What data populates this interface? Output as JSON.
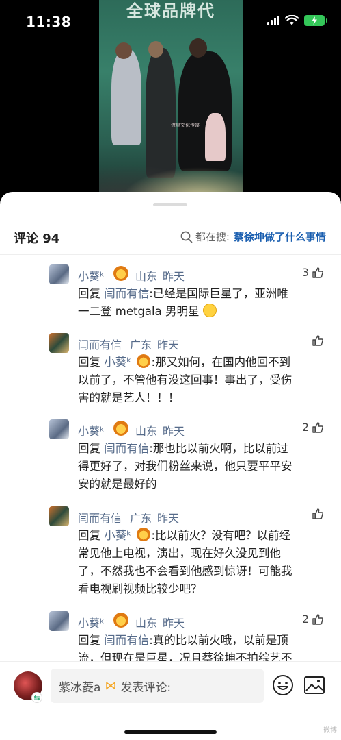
{
  "status": {
    "time": "11:38"
  },
  "video": {
    "banner": "全球品牌代",
    "watermark": "流星文化传媒"
  },
  "header": {
    "comments_label": "评论 94",
    "search_prefix": "都在搜:",
    "search_query": "蔡徐坤做了什么事情"
  },
  "replies": [
    {
      "name": "小葵ᵏ",
      "location": "山东",
      "time": "昨天",
      "likes": "3",
      "reply_prefix": "回复",
      "reply_to": "闫而有信",
      "line1": ":已经是国际巨星了，亚洲唯",
      "line2": "一二登 metgala 男明星"
    },
    {
      "name": "闫而有信",
      "location": "广东",
      "time": "昨天",
      "likes": "",
      "reply_prefix": "回复",
      "reply_to": "小葵ᵏ",
      "line1": ":那又如何，在国内他回不到",
      "line2": "以前了，不管他有没这回事！事出了，受伤",
      "line3": "害的就是艺人！！！"
    },
    {
      "name": "小葵ᵏ",
      "location": "山东",
      "time": "昨天",
      "likes": "2",
      "reply_prefix": "回复",
      "reply_to": "闫而有信",
      "line1": ":那也比以前火啊，比以前过",
      "line2": "得更好了，对我们粉丝来说，他只要平平安",
      "line3": "安的就是最好的"
    },
    {
      "name": "闫而有信",
      "location": "广东",
      "time": "昨天",
      "likes": "",
      "reply_prefix": "回复",
      "reply_to": "小葵ᵏ",
      "line1": ":比以前火？没有吧？以前经",
      "line2": "常见他上电视，演出，现在好久没见到他",
      "line3": "了，不然我也不会看到他感到惊讶！可能我",
      "line4": "看电视刷视频比较少吧？"
    },
    {
      "name": "小葵ᵏ",
      "location": "山东",
      "time": "昨天",
      "likes": "2",
      "reply_prefix": "回复",
      "reply_to": "闫而有信",
      "line1": ":真的比以前火哦，以前是顶",
      "line2": "流，但现在是巨星，况且蔡徐坤不拍综艺不"
    }
  ],
  "composer": {
    "username": "紫冰菱a",
    "placeholder": "发表评论:"
  },
  "footer": {
    "mark": "微博"
  },
  "icons": [
    "search-icon",
    "thumbs-up-icon",
    "emoji-icon",
    "image-icon",
    "lion-emoji",
    "grin-emoji"
  ]
}
